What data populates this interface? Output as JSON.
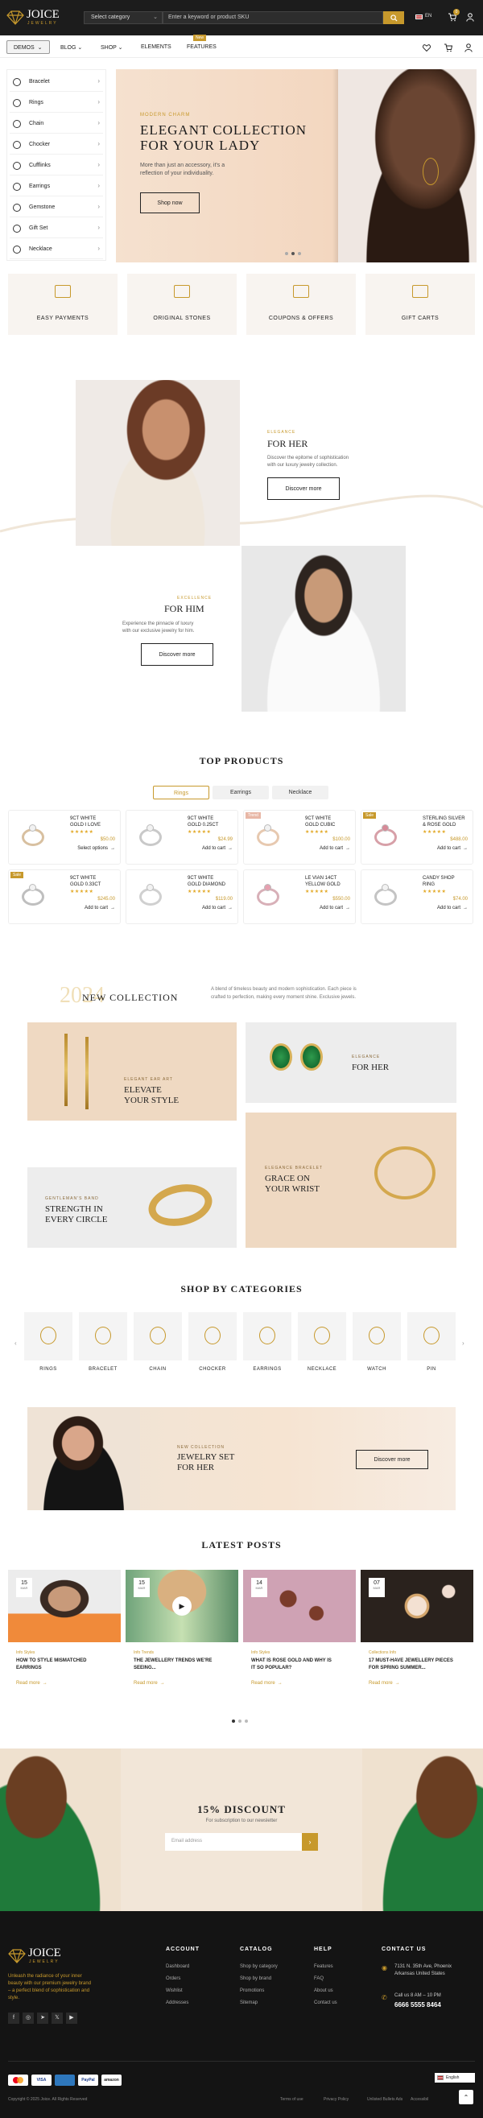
{
  "header": {
    "logo": "JOICE",
    "logo_sub": "JEWELRY",
    "category_select": "Select category",
    "search_placeholder": "Enter a keyword or product SKU",
    "lang": "EN",
    "cart_count": "0"
  },
  "nav": {
    "items": [
      "DEMOS",
      "BLOG",
      "SHOP",
      "ELEMENTS",
      "FEATURES"
    ],
    "badge": "New"
  },
  "sidebar": {
    "items": [
      "Bracelet",
      "Rings",
      "Chain",
      "Chocker",
      "Cufflinks",
      "Earrings",
      "Gemstone",
      "Gift Set",
      "Necklace"
    ]
  },
  "hero": {
    "kicker": "MODERN CHARM",
    "title1": "ELEGANT COLLECTION",
    "title2": "FOR YOUR LADY",
    "desc1": "More than just an accessory, it's a",
    "desc2": "reflection of your individuality.",
    "cta": "Shop now"
  },
  "features": [
    "EASY PAYMENTS",
    "ORIGINAL STONES",
    "COUPONS & OFFERS",
    "GIFT CARTS"
  ],
  "her": {
    "kicker": "ELEGANCE",
    "title": "FOR HER",
    "desc1": "Discover the epitome of sophistication",
    "desc2": "with our luxury jewelry collection.",
    "cta": "Discover more"
  },
  "him": {
    "kicker": "EXCELLENCE",
    "title": "FOR HIM",
    "desc1": "Experience the pinnacle of luxury",
    "desc2": "with our exclusive jewelry for him.",
    "cta": "Discover more"
  },
  "top_products": {
    "title": "TOP PRODUCTS",
    "tabs": [
      "Rings",
      "Earrings",
      "Necklace"
    ],
    "items": [
      {
        "name1": "9CT WHITE",
        "name2": "GOLD I LOVE",
        "price": "$50.00",
        "action": "Select options",
        "badge": ""
      },
      {
        "name1": "9CT WHITE",
        "name2": "GOLD 0.25CT",
        "price": "$24.99",
        "action": "Add to cart",
        "badge": ""
      },
      {
        "name1": "9CT WHITE",
        "name2": "GOLD CUBIC",
        "price": "$100.00",
        "action": "Add to cart",
        "badge": "Trend"
      },
      {
        "name1": "STERLING SILVER",
        "name2": "& ROSE GOLD",
        "price": "$488.00",
        "action": "Add to cart",
        "badge": "Sale"
      },
      {
        "name1": "9CT WHITE",
        "name2": "GOLD 0.33CT",
        "price": "$245.00",
        "action": "Add to cart",
        "badge": "Sale"
      },
      {
        "name1": "9CT WHITE",
        "name2": "GOLD DIAMOND",
        "price": "$119.00",
        "action": "Add to cart",
        "badge": ""
      },
      {
        "name1": "LE VIAN 14CT",
        "name2": "YELLOW GOLD",
        "price": "$550.00",
        "action": "Add to cart",
        "badge": ""
      },
      {
        "name1": "CANDY SHOP",
        "name2": "RING",
        "price": "$74.00",
        "action": "Add to cart",
        "badge": ""
      }
    ]
  },
  "new_collection": {
    "year": "2024",
    "title": "NEW COLLECTION",
    "desc1": "A blend of timeless beauty and modern sophistication. Each piece is",
    "desc2": "crafted to perfection, making every moment shine. Exclusive jewels."
  },
  "banners": [
    {
      "kicker": "ELEGANT EAR ART",
      "t1": "ELEVATE",
      "t2": "YOUR STYLE"
    },
    {
      "kicker": "ELEGANCE",
      "t1": "FOR HER",
      "t2": ""
    },
    {
      "kicker": "GENTLEMAN'S BAND",
      "t1": "STRENGTH IN",
      "t2": "EVERY CIRCLE"
    },
    {
      "kicker": "ELEGANCE BRACELET",
      "t1": "GRACE ON",
      "t2": "YOUR WRIST"
    }
  ],
  "categories": {
    "title": "SHOP BY CATEGORIES",
    "items": [
      "RINGS",
      "BRACELET",
      "CHAIN",
      "CHOCKER",
      "EARRINGS",
      "NECKLACE",
      "WATCH",
      "PIN"
    ]
  },
  "jewelry_set": {
    "kicker": "NEW COLLECTION",
    "t1": "JEWELRY SET",
    "t2": "FOR HER",
    "cta": "Discover more"
  },
  "posts": {
    "title": "LATEST POSTS",
    "items": [
      {
        "day": "15",
        "mon": "MAR",
        "cat": "Info Styles",
        "t1": "HOW TO STYLE MISMATCHED",
        "t2": "EARRINGS",
        "more": "Read more"
      },
      {
        "day": "15",
        "mon": "MAR",
        "cat": "Info Trends",
        "t1": "THE JEWELLERY TRENDS WE'RE",
        "t2": "SEEING...",
        "more": "Read more"
      },
      {
        "day": "14",
        "mon": "MAR",
        "cat": "Info Styles",
        "t1": "WHAT IS ROSE GOLD AND WHY IS",
        "t2": "IT SO POPULAR?",
        "more": "Read more"
      },
      {
        "day": "07",
        "mon": "MAR",
        "cat": "Collections Info",
        "t1": "17 MUST-HAVE JEWELLERY PIECES",
        "t2": "FOR SPRING SUMMER...",
        "more": "Read more"
      }
    ]
  },
  "discount": {
    "title": "15% DISCOUNT",
    "sub": "For subscription to our newsletter",
    "placeholder": "Email address"
  },
  "footer": {
    "desc1": "Unleash the radiance of your inner",
    "desc2": "beauty with our premium jewelry brand",
    "desc3": "– a perfect blend of sophistication and",
    "desc4": "style.",
    "cols": [
      {
        "title": "ACCOUNT",
        "links": [
          "Dashboard",
          "Orders",
          "Wishlist",
          "Addresses"
        ]
      },
      {
        "title": "CATALOG",
        "links": [
          "Shop by category",
          "Shop by brand",
          "Promotions",
          "Sitemap"
        ]
      },
      {
        "title": "HELP",
        "links": [
          "Features",
          "FAQ",
          "About us",
          "Contact us"
        ]
      }
    ],
    "contact_title": "CONTACT US",
    "addr1": "7131 N. 35th Ave, Phoenix",
    "addr2": "Arkansas United States",
    "hours": "Call us 8 AM – 10 PM",
    "phone": "6666 5555 8464",
    "copyright": "Copyright © 2025 Joice. All Rights Reserved",
    "links": [
      "Terms of use",
      "Privacy Policy",
      "Unlisted Bullets Ads",
      "Accessibility"
    ],
    "lang": "English",
    "payments": [
      "VISA",
      "PayPal",
      "amazon"
    ]
  }
}
